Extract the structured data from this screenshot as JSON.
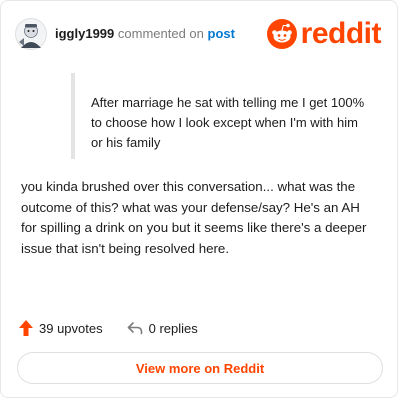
{
  "header": {
    "username": "iggly1999",
    "commented_on": "commented on",
    "post_link": "post",
    "logo_text": "reddit"
  },
  "comment": {
    "quote": "After marriage he sat with telling me I get 100% to choose how I look except when I'm with him or his family",
    "body": "you kinda brushed over this conversation... what was the outcome of this? what was your defense/say? He's an AH for spilling a drink on you but it seems like there's a deeper issue that isn't being resolved here."
  },
  "stats": {
    "upvotes": "39 upvotes",
    "replies": "0 replies"
  },
  "footer": {
    "view_more": "View more on Reddit"
  },
  "colors": {
    "brand": "#ff4500",
    "link": "#0079d3",
    "text": "#1c1c1c",
    "muted": "#7c7c7c"
  },
  "icons": [
    "avatar-icon",
    "reddit-alien-icon",
    "upvote-arrow-icon",
    "reply-arrow-icon"
  ]
}
